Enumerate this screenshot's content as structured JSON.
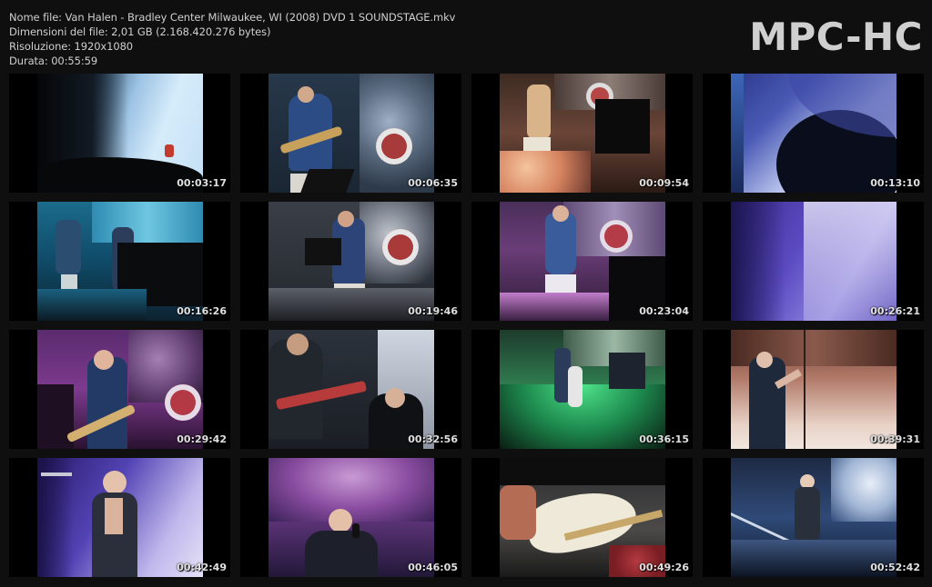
{
  "info": {
    "filename": "Nome file: Van Halen - Bradley Center Milwaukee, WI (2008) DVD 1 SOUNDSTAGE.mkv",
    "filesize": "Dimensioni del file: 2,01 GB (2.168.420.276 bytes)",
    "resolution": "Risoluzione: 1920x1080",
    "duration": "Durata: 00:55:59"
  },
  "logo": "MPC-HC",
  "thumbnails": [
    {
      "time": "00:03:17",
      "scene": "stage-light-blue"
    },
    {
      "time": "00:06:35",
      "scene": "guitarist-drums"
    },
    {
      "time": "00:09:54",
      "scene": "stage-orange"
    },
    {
      "time": "00:13:10",
      "scene": "purple-light"
    },
    {
      "time": "00:16:26",
      "scene": "blue-stage"
    },
    {
      "time": "00:19:46",
      "scene": "bass-drums"
    },
    {
      "time": "00:23:04",
      "scene": "guitarist-purple"
    },
    {
      "time": "00:26:21",
      "scene": "purple-screen"
    },
    {
      "time": "00:29:42",
      "scene": "guitarist-pink"
    },
    {
      "time": "00:32:56",
      "scene": "two-players"
    },
    {
      "time": "00:36:15",
      "scene": "green-stage"
    },
    {
      "time": "00:39:31",
      "scene": "singer-bright"
    },
    {
      "time": "00:42:49",
      "scene": "singer-mic"
    },
    {
      "time": "00:46:05",
      "scene": "singer-purple"
    },
    {
      "time": "00:49:26",
      "scene": "guitar-closeup"
    },
    {
      "time": "00:52:42",
      "scene": "singer-stage"
    }
  ]
}
